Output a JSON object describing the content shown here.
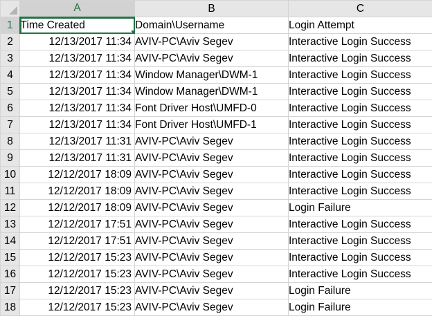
{
  "columns": [
    "A",
    "B",
    "C"
  ],
  "header_row": {
    "number": "1",
    "cells": [
      "Time Created",
      "Domain\\Username",
      "Login Attempt"
    ]
  },
  "rows": [
    {
      "n": "2",
      "time": "12/13/2017 11:34",
      "user": "AVIV-PC\\Aviv Segev",
      "attempt": "Interactive Login Success"
    },
    {
      "n": "3",
      "time": "12/13/2017 11:34",
      "user": "AVIV-PC\\Aviv Segev",
      "attempt": "Interactive Login Success"
    },
    {
      "n": "4",
      "time": "12/13/2017 11:34",
      "user": "Window Manager\\DWM-1",
      "attempt": "Interactive Login Success"
    },
    {
      "n": "5",
      "time": "12/13/2017 11:34",
      "user": "Window Manager\\DWM-1",
      "attempt": "Interactive Login Success"
    },
    {
      "n": "6",
      "time": "12/13/2017 11:34",
      "user": "Font Driver Host\\UMFD-0",
      "attempt": "Interactive Login Success"
    },
    {
      "n": "7",
      "time": "12/13/2017 11:34",
      "user": "Font Driver Host\\UMFD-1",
      "attempt": "Interactive Login Success"
    },
    {
      "n": "8",
      "time": "12/13/2017 11:31",
      "user": "AVIV-PC\\Aviv Segev",
      "attempt": "Interactive Login Success"
    },
    {
      "n": "9",
      "time": "12/13/2017 11:31",
      "user": "AVIV-PC\\Aviv Segev",
      "attempt": "Interactive Login Success"
    },
    {
      "n": "10",
      "time": "12/12/2017 18:09",
      "user": "AVIV-PC\\Aviv Segev",
      "attempt": "Interactive Login Success"
    },
    {
      "n": "11",
      "time": "12/12/2017 18:09",
      "user": "AVIV-PC\\Aviv Segev",
      "attempt": "Interactive Login Success"
    },
    {
      "n": "12",
      "time": "12/12/2017 18:09",
      "user": "AVIV-PC\\Aviv Segev",
      "attempt": "Login Failure"
    },
    {
      "n": "13",
      "time": "12/12/2017 17:51",
      "user": "AVIV-PC\\Aviv Segev",
      "attempt": "Interactive Login Success"
    },
    {
      "n": "14",
      "time": "12/12/2017 17:51",
      "user": "AVIV-PC\\Aviv Segev",
      "attempt": "Interactive Login Success"
    },
    {
      "n": "15",
      "time": "12/12/2017 15:23",
      "user": "AVIV-PC\\Aviv Segev",
      "attempt": "Interactive Login Success"
    },
    {
      "n": "16",
      "time": "12/12/2017 15:23",
      "user": "AVIV-PC\\Aviv Segev",
      "attempt": "Interactive Login Success"
    },
    {
      "n": "17",
      "time": "12/12/2017 15:23",
      "user": "AVIV-PC\\Aviv Segev",
      "attempt": "Login Failure"
    },
    {
      "n": "18",
      "time": "12/12/2017 15:23",
      "user": "AVIV-PC\\Aviv Segev",
      "attempt": "Login Failure"
    }
  ],
  "colors": {
    "accent": "#217346",
    "header_bg": "#e6e6e6",
    "gridline": "#d4d4d4"
  }
}
